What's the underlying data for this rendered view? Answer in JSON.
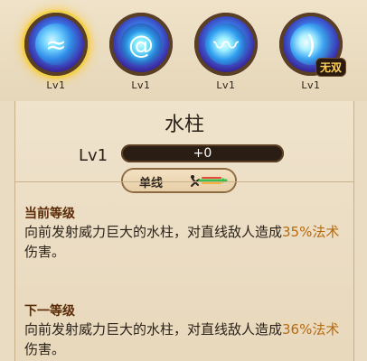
{
  "skills": [
    {
      "level_label": "Lv1",
      "icon": "water-swirl-icon",
      "selected": true
    },
    {
      "level_label": "Lv1",
      "icon": "vortex-icon",
      "selected": false
    },
    {
      "level_label": "Lv1",
      "icon": "wave-fish-icon",
      "selected": false
    },
    {
      "level_label": "Lv1",
      "icon": "bow-wave-icon",
      "selected": false,
      "badge": "无双"
    }
  ],
  "detail": {
    "title": "水柱",
    "level_label": "Lv1",
    "exp_text": "+0",
    "exp_fraction": 0.0,
    "type_label": "单线",
    "sections": [
      {
        "heading": "当前等级",
        "text_before": "向前发射威力巨大的水柱，对直线敌人造成",
        "highlight": "35%法术",
        "text_after": "伤害。"
      },
      {
        "heading": "下一等级",
        "text_before": "向前发射威力巨大的水柱，对直线敌人造成",
        "highlight": "36%法术",
        "text_after": "伤害。"
      }
    ]
  }
}
